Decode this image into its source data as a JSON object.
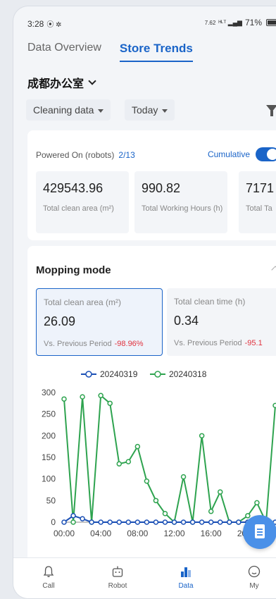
{
  "status_bar": {
    "time": "3:28",
    "left_icons": "⦿ ✲",
    "net_speed": "7.62",
    "signal": "ᴴᴸᵀ ▂▄▆",
    "battery": "71%"
  },
  "tabs": [
    {
      "label": "Data Overview",
      "active": false
    },
    {
      "label": "Store Trends",
      "active": true
    }
  ],
  "store_name": "成都办公室",
  "filters": {
    "data_type": "Cleaning data",
    "period": "Today"
  },
  "summary": {
    "powered_label": "Powered On (robots)",
    "powered_value": "2/13",
    "cumulative_label": "Cumulative",
    "cumulative_on": true,
    "stats": [
      {
        "value": "429543.96",
        "label": "Total clean area (m²)"
      },
      {
        "value": "990.82",
        "label": "Total Working Hours (h)"
      },
      {
        "value": "7171",
        "label": "Total Ta"
      }
    ]
  },
  "mopping": {
    "title": "Mopping mode",
    "metrics": [
      {
        "label": "Total clean area (m²)",
        "value": "26.09",
        "compare_label": "Vs. Previous Period",
        "compare_value": "-98.96%"
      },
      {
        "label": "Total clean time (h)",
        "value": "0.34",
        "compare_label": "Vs. Previous Period",
        "compare_value": "-95.1"
      }
    ]
  },
  "chart_data": {
    "type": "line",
    "x": [
      "00:00",
      "01:00",
      "02:00",
      "03:00",
      "04:00",
      "05:00",
      "06:00",
      "07:00",
      "08:00",
      "09:00",
      "10:00",
      "11:00",
      "12:00",
      "13:00",
      "14:00",
      "15:00",
      "16:00",
      "17:00",
      "18:00",
      "19:00",
      "20:00",
      "21:00",
      "22:00",
      "23:00"
    ],
    "x_tick_labels": [
      "00:00",
      "04:00",
      "08:00",
      "12:00",
      "16:00",
      "20:00"
    ],
    "y_ticks": [
      0,
      50,
      100,
      150,
      200,
      250,
      300
    ],
    "ylim": [
      0,
      300
    ],
    "series": [
      {
        "name": "20240319",
        "color": "#1a4fb5",
        "values": [
          0,
          15,
          8,
          0,
          0,
          0,
          0,
          0,
          0,
          0,
          0,
          0,
          0,
          0,
          0,
          0,
          0,
          0,
          0,
          0,
          0,
          0,
          0,
          0
        ]
      },
      {
        "name": "20240318",
        "color": "#2ea34f",
        "values": [
          285,
          0,
          290,
          0,
          293,
          275,
          135,
          140,
          175,
          95,
          50,
          20,
          0,
          105,
          0,
          200,
          25,
          70,
          0,
          0,
          15,
          45,
          0,
          270
        ]
      }
    ]
  },
  "nav": [
    {
      "label": "Call",
      "icon": "bell-icon",
      "active": false
    },
    {
      "label": "Robot",
      "icon": "robot-icon",
      "active": false
    },
    {
      "label": "Data",
      "icon": "bar-chart-icon",
      "active": true
    },
    {
      "label": "My",
      "icon": "smiley-icon",
      "active": false
    }
  ]
}
